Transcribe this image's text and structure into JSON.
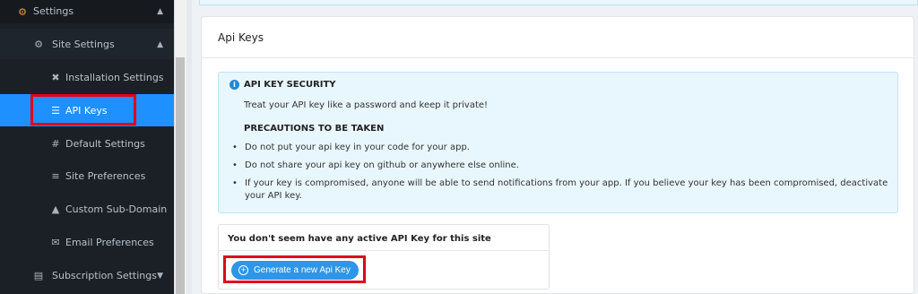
{
  "sidebar": {
    "settings": {
      "label": "Settings",
      "icon": "gear-icon"
    },
    "site_settings": {
      "label": "Site Settings",
      "icon": "gear-icon"
    },
    "items": [
      {
        "label": "Installation Settings",
        "icon": "tools-icon"
      },
      {
        "label": "API Keys",
        "icon": "keys-icon",
        "active": true
      },
      {
        "label": "Default Settings",
        "icon": "grid-icon"
      },
      {
        "label": "Site Preferences",
        "icon": "sliders-icon"
      },
      {
        "label": "Custom Sub-Domain",
        "icon": "sitemap-icon"
      },
      {
        "label": "Email Preferences",
        "icon": "envelope-icon"
      }
    ],
    "subscription": {
      "label": "Subscription Settings",
      "icon": "document-icon"
    }
  },
  "main": {
    "title": "Api Keys",
    "alert": {
      "title": "API KEY SECURITY",
      "text": "Treat your API key like a password and keep it private!",
      "precautions_title": "PRECAUTIONS TO BE TAKEN",
      "precautions": [
        "Do not put your api key in your code for your app.",
        "Do not share your api key on github or anywhere else online.",
        "If your key is compromised, anyone will be able to send notifications from your app. If you believe your key has been compromised, deactivate your API key."
      ]
    },
    "no_key_message": "You don't seem have any active API Key for this site",
    "generate_button": "Generate a new Api Key"
  },
  "colors": {
    "sidebar_bg": "#1b2026",
    "active_item": "#1e90ff",
    "highlight": "#e0001b",
    "button": "#2e96e8",
    "alert_bg": "#e8f6fd"
  }
}
